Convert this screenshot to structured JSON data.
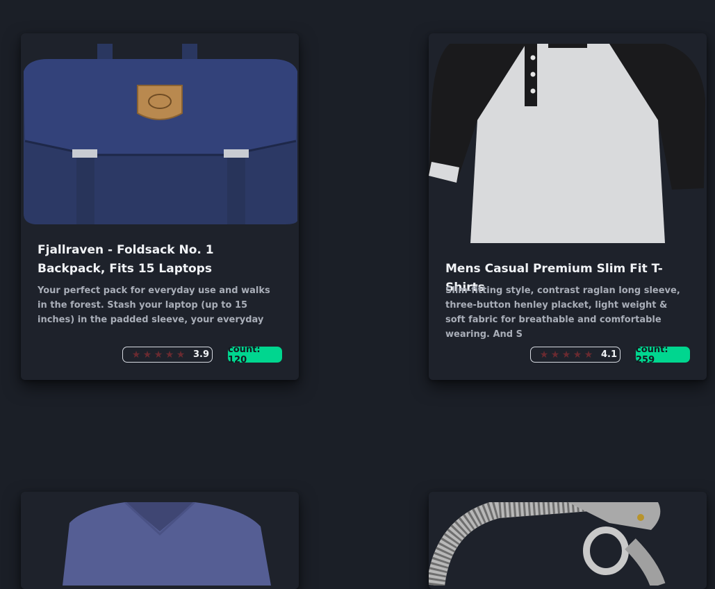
{
  "products": [
    {
      "title": "Fjallraven - Foldsack No. 1 Backpack, Fits 15 Laptops",
      "description": "Your perfect pack for everyday use and walks in the forest. Stash your laptop (up to 15 inches) in the padded sleeve, your everyday",
      "rating": "3.9",
      "count": "count: 120",
      "image": "backpack"
    },
    {
      "title": "Mens Casual Premium Slim Fit T-Shirts",
      "description": "Slim-fitting style, contrast raglan long sleeve, three-button henley placket, light weight & soft fabric for breathable and comfortable wearing. And S",
      "rating": "4.1",
      "count": "count: 259",
      "image": "henley-shirt"
    },
    {
      "image": "v-neck-shirt"
    },
    {
      "image": "chain-bracelet"
    }
  ],
  "colors": {
    "background": "#1b1f27",
    "card": "#1e222b",
    "accent": "#00d68f",
    "star": "#6a2a30"
  }
}
